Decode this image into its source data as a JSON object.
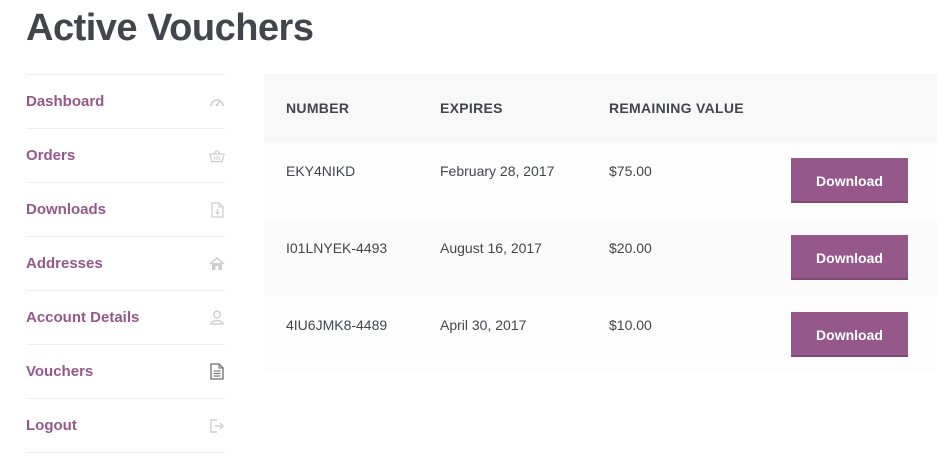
{
  "page": {
    "title": "Active Vouchers"
  },
  "sidebar": {
    "items": [
      {
        "label": "Dashboard",
        "icon": "dashboard-icon"
      },
      {
        "label": "Orders",
        "icon": "basket-icon"
      },
      {
        "label": "Downloads",
        "icon": "file-download-icon"
      },
      {
        "label": "Addresses",
        "icon": "home-icon"
      },
      {
        "label": "Account Details",
        "icon": "user-icon"
      },
      {
        "label": "Vouchers",
        "icon": "document-icon",
        "active": true
      },
      {
        "label": "Logout",
        "icon": "sign-out-icon"
      }
    ]
  },
  "table": {
    "headers": {
      "number": "NUMBER",
      "expires": "EXPIRES",
      "remaining": "REMAINING VALUE"
    },
    "rows": [
      {
        "number": "EKY4NIKD",
        "expires": "February 28, 2017",
        "remaining": "$75.00",
        "action": "Download"
      },
      {
        "number": "I01LNYEK-4493",
        "expires": "August 16, 2017",
        "remaining": "$20.00",
        "action": "Download"
      },
      {
        "number": "4IU6JMK8-4489",
        "expires": "April 30, 2017",
        "remaining": "$10.00",
        "action": "Download"
      }
    ]
  },
  "colors": {
    "accent": "#96588a",
    "text": "#43454b",
    "header_bg": "#f8f8f8",
    "border": "#eeeeee"
  }
}
